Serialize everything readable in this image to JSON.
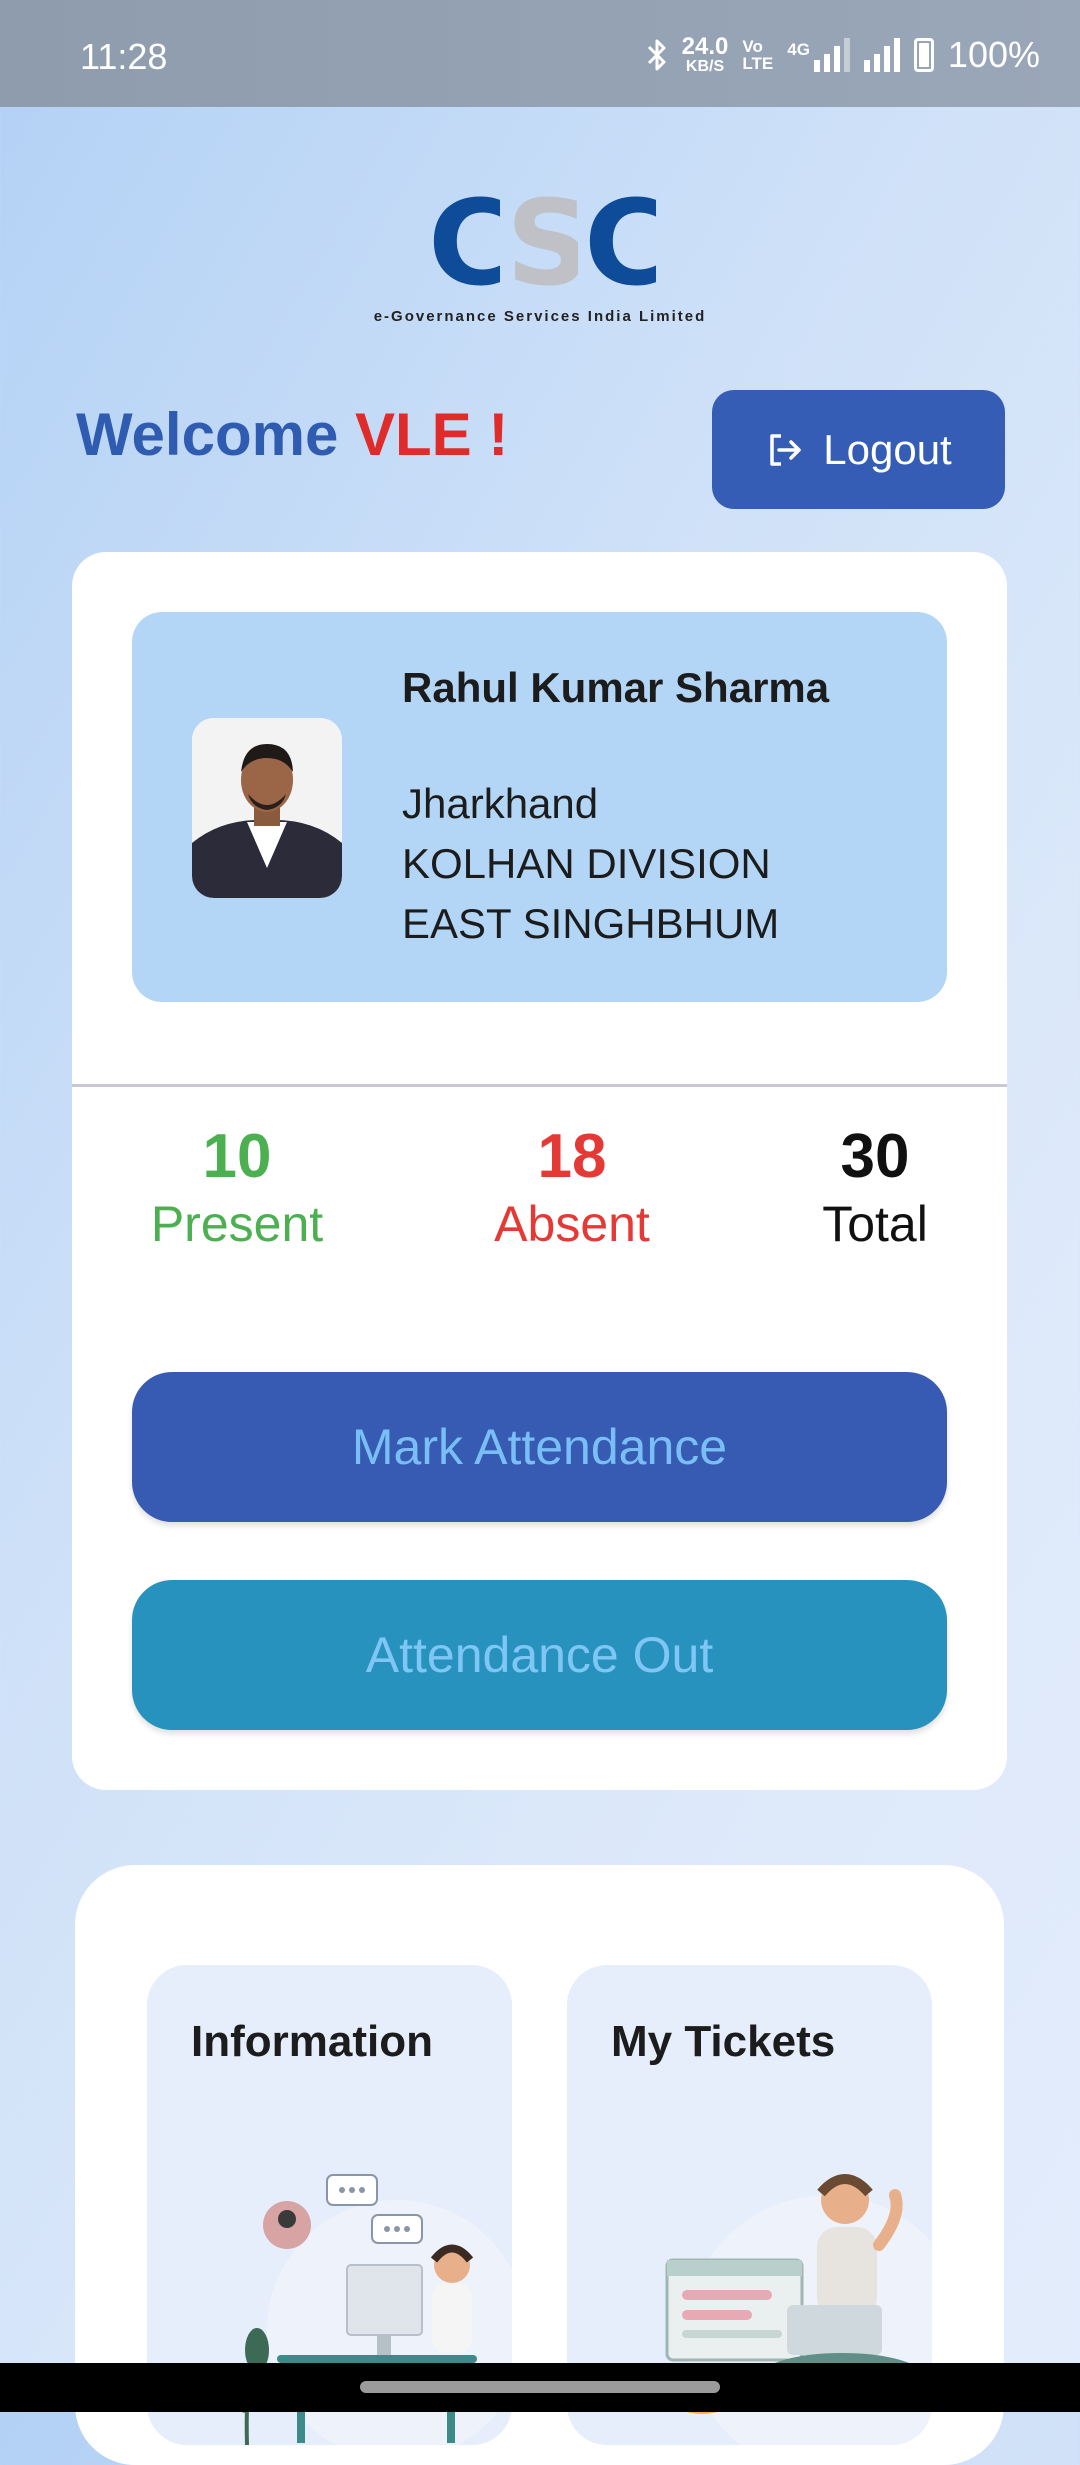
{
  "status_bar": {
    "time": "11:28",
    "net_speed_value": "24.0",
    "net_speed_unit": "KB/S",
    "volte_top": "Vo",
    "volte_bottom": "LTE",
    "network_type": "4G",
    "battery_percent": "100%",
    "icons": [
      "bluetooth-icon",
      "signal-icon",
      "signal-icon",
      "battery-icon"
    ]
  },
  "logo": {
    "letters": [
      "C",
      "S",
      "C"
    ],
    "subtitle": "e-Governance Services India Limited"
  },
  "header": {
    "welcome_text": "Welcome",
    "user_role": "VLE !",
    "logout_label": "Logout",
    "logout_icon": "logout-icon"
  },
  "profile": {
    "name": "Rahul Kumar Sharma",
    "state": "Jharkhand",
    "division": "KOLHAN DIVISION",
    "district": "EAST SINGHBHUM"
  },
  "stats": {
    "present_count": "10",
    "present_label": "Present",
    "absent_count": "18",
    "absent_label": "Absent",
    "total_count": "30",
    "total_label": "Total"
  },
  "actions": {
    "mark_attendance": "Mark Attendance",
    "attendance_out": "Attendance Out"
  },
  "tiles": [
    {
      "title": "Information"
    },
    {
      "title": "My Tickets"
    }
  ],
  "colors": {
    "primary_blue": "#355db5",
    "teal": "#2892be",
    "present_green": "#4caf50",
    "absent_red": "#e53935",
    "welcome_red": "#e02b2b",
    "profile_bg": "#b3d6f7"
  }
}
